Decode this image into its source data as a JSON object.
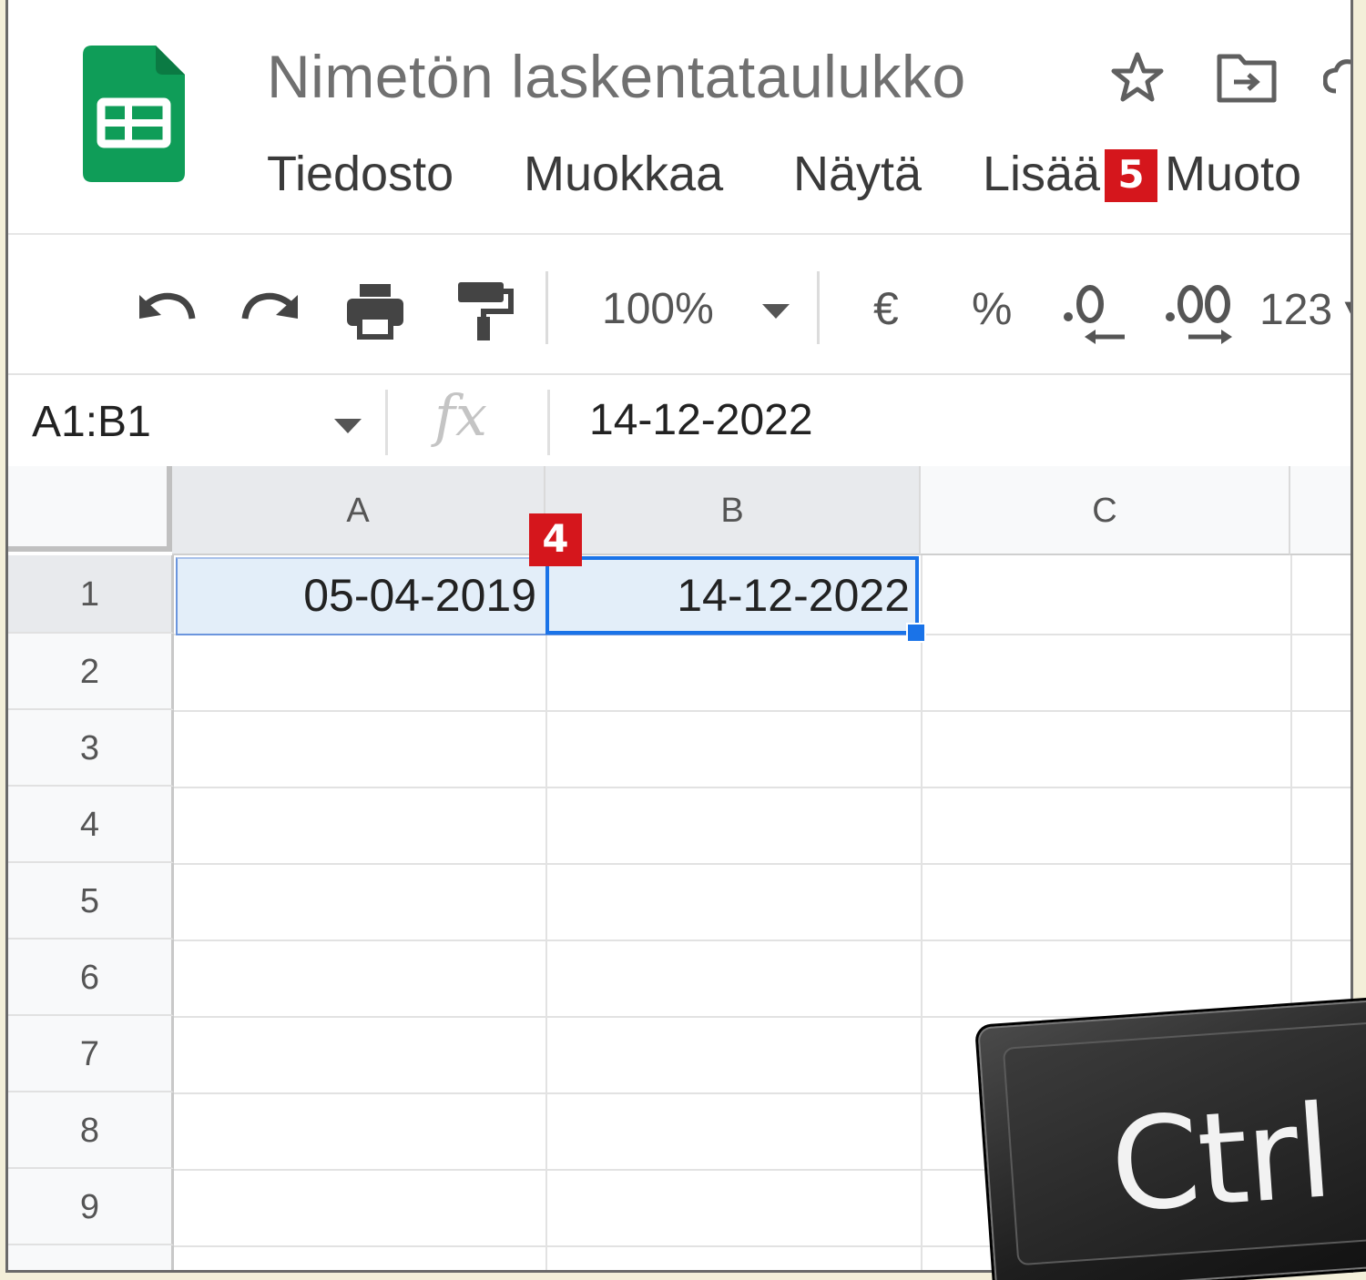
{
  "header": {
    "title": "Nimetön laskentataulukko"
  },
  "menu": {
    "file": "Tiedosto",
    "edit": "Muokkaa",
    "view": "Näytä",
    "insert": "Lisää",
    "format": "Muoto"
  },
  "annotations": {
    "step_5": "5",
    "step_4": "4"
  },
  "toolbar": {
    "zoom": "100%",
    "currency": "€",
    "percent": "%",
    "more_formats": "123"
  },
  "formula_bar": {
    "name_box": "A1:B1",
    "fx": "fx",
    "value": "14-12-2022"
  },
  "grid": {
    "columns": [
      "A",
      "B",
      "C"
    ],
    "rows": [
      "1",
      "2",
      "3",
      "4",
      "5",
      "6",
      "7",
      "8",
      "9"
    ],
    "cells": {
      "A1": "05-04-2019",
      "B1": "14-12-2022"
    }
  },
  "overlay": {
    "key_label": "Ctrl"
  },
  "colors": {
    "sheets_green": "#0f9d58",
    "selection_blue": "#1a73e8",
    "badge_red": "#d5161c"
  }
}
